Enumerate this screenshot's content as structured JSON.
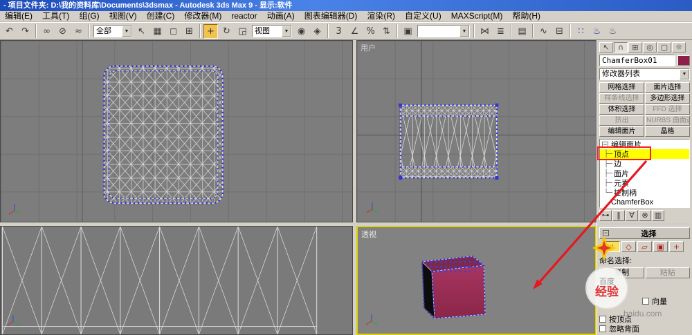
{
  "title_bar": {
    "title": "- 项目文件夹: D:\\我的资料库\\Documents\\3dsmax    - Autodesk 3ds Max 9    - 显示:软件"
  },
  "menu": {
    "items": [
      {
        "name": "edit",
        "label": "编辑(E)"
      },
      {
        "name": "tools",
        "label": "工具(T)"
      },
      {
        "name": "group",
        "label": "组(G)"
      },
      {
        "name": "views",
        "label": "视图(V)"
      },
      {
        "name": "create",
        "label": "创建(C)"
      },
      {
        "name": "modifiers",
        "label": "修改器(M)"
      },
      {
        "name": "reactor",
        "label": "reactor"
      },
      {
        "name": "animation",
        "label": "动画(A)"
      },
      {
        "name": "graph-editors",
        "label": "图表编辑器(D)"
      },
      {
        "name": "rendering",
        "label": "渲染(R)"
      },
      {
        "name": "customize",
        "label": "自定义(U)"
      },
      {
        "name": "maxscript",
        "label": "MAXScript(M)"
      },
      {
        "name": "help",
        "label": "帮助(H)"
      }
    ]
  },
  "toolbar": {
    "items": [
      {
        "name": "undo",
        "glyph": "↶"
      },
      {
        "name": "redo",
        "glyph": "↷"
      },
      {
        "type": "sep"
      },
      {
        "name": "select-and-link",
        "glyph": "∞"
      },
      {
        "name": "unlink-selection",
        "glyph": "⊘"
      },
      {
        "name": "bind-to-space-warp",
        "glyph": "≈"
      },
      {
        "type": "sep"
      },
      {
        "type": "dropdown",
        "name": "selection-filter",
        "value": "全部",
        "width": 56
      },
      {
        "name": "select-object",
        "glyph": "↖"
      },
      {
        "name": "select-by-name",
        "glyph": "▦"
      },
      {
        "name": "rectangular-selection-region",
        "glyph": "◻"
      },
      {
        "name": "window-crossing-toggle",
        "glyph": "⊞"
      },
      {
        "type": "sep"
      },
      {
        "name": "select-and-move",
        "glyph": "+",
        "active": true
      },
      {
        "name": "select-and-rotate",
        "glyph": "↻"
      },
      {
        "name": "select-and-uniform-scale",
        "glyph": "◲"
      },
      {
        "type": "dropdown",
        "name": "reference-coordinate-system",
        "value": "视图",
        "width": 58
      },
      {
        "name": "use-pivot-point-center",
        "glyph": "◉"
      },
      {
        "name": "select-and-manipulate",
        "glyph": "◈"
      },
      {
        "type": "sep"
      },
      {
        "name": "snaps-toggle-3d",
        "glyph": "3"
      },
      {
        "name": "angle-snap-toggle",
        "glyph": "∠"
      },
      {
        "name": "percent-snap-toggle",
        "glyph": "%"
      },
      {
        "name": "spinner-snap-toggle",
        "glyph": "⇅"
      },
      {
        "type": "sep"
      },
      {
        "name": "edit-named-selection-sets",
        "glyph": "▣"
      },
      {
        "type": "dropdown",
        "name": "named-selection-sets",
        "value": "",
        "width": 76
      },
      {
        "type": "sep"
      },
      {
        "name": "mirror",
        "glyph": "⋈"
      },
      {
        "name": "align",
        "glyph": "≣"
      },
      {
        "type": "sep"
      },
      {
        "name": "layer-manager",
        "glyph": "▤"
      },
      {
        "type": "sep"
      },
      {
        "name": "curve-editor",
        "glyph": "∿"
      },
      {
        "name": "schematic-view",
        "glyph": "⊟"
      },
      {
        "type": "sep"
      },
      {
        "name": "material-editor",
        "glyph": "∷",
        "color": "#2b46c8"
      },
      {
        "name": "render-scene",
        "glyph": "♨",
        "color": "#30409a"
      },
      {
        "name": "quick-render",
        "glyph": "♨",
        "color": "#555555"
      }
    ]
  },
  "viewports": {
    "top_right_label": "用户",
    "bottom_right_label": "透视"
  },
  "command_panel": {
    "tabs": [
      {
        "name": "create",
        "glyph": "↖"
      },
      {
        "name": "modify",
        "glyph": "∩",
        "active": true
      },
      {
        "name": "hierarchy",
        "glyph": "⊞"
      },
      {
        "name": "motion",
        "glyph": "◎"
      },
      {
        "name": "display",
        "glyph": "▢"
      },
      {
        "name": "utilities",
        "glyph": "☼"
      }
    ],
    "object_name": "ChamferBox01",
    "object_color": "#8e1f4b",
    "modifier_list_label": "修改器列表",
    "modifier_buttons": [
      {
        "name": "mesh-select",
        "label": "网格选择",
        "enabled": true
      },
      {
        "name": "patch-select",
        "label": "面片选择",
        "enabled": true
      },
      {
        "name": "spline-select",
        "label": "样条线选择",
        "enabled": false
      },
      {
        "name": "poly-select",
        "label": "多边形选择",
        "enabled": true
      },
      {
        "name": "vol-select",
        "label": "体积选择",
        "enabled": true
      },
      {
        "name": "ffd-select",
        "label": "FFD 选择",
        "enabled": false
      },
      {
        "name": "extrude",
        "label": "挤出",
        "enabled": false
      },
      {
        "name": "nurbs-surface-select",
        "label": "NURBS 曲面选择",
        "enabled": false
      },
      {
        "name": "edit-patch",
        "label": "编辑面片",
        "enabled": true
      },
      {
        "name": "lattice",
        "label": "晶格",
        "enabled": true
      }
    ],
    "stack_items": [
      {
        "name": "edit-patch",
        "label": "编辑面片",
        "level": 0,
        "expander": true
      },
      {
        "name": "vertex",
        "label": "顶点",
        "level": 1,
        "selected": true
      },
      {
        "name": "edge",
        "label": "边",
        "level": 1
      },
      {
        "name": "patch",
        "label": "面片",
        "level": 1
      },
      {
        "name": "element",
        "label": "元素",
        "level": 1
      },
      {
        "name": "handles",
        "label": "控制柄",
        "level": 1
      },
      {
        "name": "chamferbox",
        "label": "ChamferBox",
        "level": 0
      }
    ],
    "stack_tools": [
      {
        "name": "pin-stack",
        "glyph": "⊶"
      },
      {
        "name": "show-end-result",
        "glyph": "‖"
      },
      {
        "name": "make-unique",
        "glyph": "∀"
      },
      {
        "name": "remove-modifier",
        "glyph": "⊗"
      },
      {
        "name": "configure-modifier-sets",
        "glyph": "▥"
      }
    ],
    "selection_rollout": {
      "title": "选择",
      "subobject_icons": [
        {
          "name": "vertex",
          "glyph": "∴",
          "active": true
        },
        {
          "name": "edge",
          "glyph": "◇"
        },
        {
          "name": "patch",
          "glyph": "▱"
        },
        {
          "name": "element",
          "glyph": "▣"
        },
        {
          "name": "handle",
          "glyph": "+"
        }
      ],
      "named_selection_label": "命名选择:",
      "copy_label": "复制",
      "paste_label": "粘贴",
      "checkbox_vector": "向量",
      "checkbox_by_vertex": "按顶点",
      "checkbox_ignore_backfacing": "忽略背面"
    }
  },
  "watermark": {
    "brand_top": "百度",
    "brand_bottom": "经验",
    "domain": "baidu.com"
  },
  "annotation": {
    "highlight_target": "顶点"
  },
  "colors": {
    "selection_highlight": "#ffff00",
    "annotation_red": "#e8161d",
    "vertex_blue": "#3434d6",
    "object_color": "#8e1f4b",
    "active_viewport_border": "#ddd100"
  }
}
